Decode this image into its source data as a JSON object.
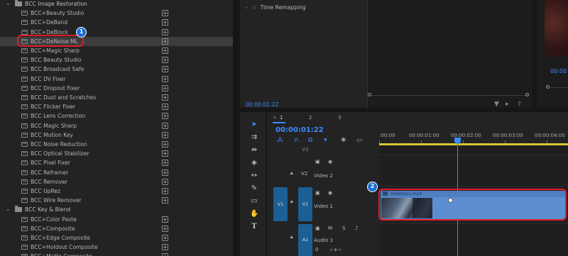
{
  "effects_panel": {
    "items": [
      {
        "type": "category",
        "label": "BCC Image Restoration"
      },
      {
        "type": "effect",
        "label": "BCC+Beauty Studio"
      },
      {
        "type": "effect",
        "label": "BCC+DeBand"
      },
      {
        "type": "effect",
        "label": "BCC+DeBlock"
      },
      {
        "type": "effect",
        "label": "BCC+DeNoise ML",
        "selected": true
      },
      {
        "type": "effect",
        "label": "BCC+Magic Sharp"
      },
      {
        "type": "effect",
        "label": "BCC Beauty Studio"
      },
      {
        "type": "effect",
        "label": "BCC Broadcast Safe"
      },
      {
        "type": "effect",
        "label": "BCC DV Fixer"
      },
      {
        "type": "effect",
        "label": "BCC Dropout Fixer"
      },
      {
        "type": "effect",
        "label": "BCC Dust and Scratches"
      },
      {
        "type": "effect",
        "label": "BCC Flicker Fixer"
      },
      {
        "type": "effect",
        "label": "BCC Lens Correction"
      },
      {
        "type": "effect",
        "label": "BCC Magic Sharp"
      },
      {
        "type": "effect",
        "label": "BCC Motion Key"
      },
      {
        "type": "effect",
        "label": "BCC Noise Reduction"
      },
      {
        "type": "effect",
        "label": "BCC Optical Stabilizer"
      },
      {
        "type": "effect",
        "label": "BCC Pixel Fixer"
      },
      {
        "type": "effect",
        "label": "BCC Reframer"
      },
      {
        "type": "effect",
        "label": "BCC Remover"
      },
      {
        "type": "effect",
        "label": "BCC UpRez"
      },
      {
        "type": "effect",
        "label": "BCC Wire Remover"
      },
      {
        "type": "category",
        "label": "BCC Key & Blend"
      },
      {
        "type": "effect",
        "label": "BCC+Color Paste"
      },
      {
        "type": "effect",
        "label": "BCC+Composite"
      },
      {
        "type": "effect",
        "label": "BCC+Edge Composite"
      },
      {
        "type": "effect",
        "label": "BCC+Holdout Composite"
      },
      {
        "type": "effect",
        "label": "BCC+Matte Composite"
      }
    ]
  },
  "annotations": [
    {
      "number": "1"
    },
    {
      "number": "2"
    }
  ],
  "effect_controls": {
    "property": "Time Remapping",
    "timecode": "00:00:01:22"
  },
  "program_monitor": {
    "timecode": "00:00"
  },
  "timeline": {
    "tabs": [
      "1",
      "2",
      "3"
    ],
    "close_glyph": "×",
    "timecode": "00:00:01:22",
    "ruler_labels": [
      ":00:00",
      "00:00:01:00",
      "00:00:02:00",
      "00:00:03:00",
      "00:00:04:00"
    ],
    "tracks": {
      "v3": {
        "name": "V3"
      },
      "v2": {
        "name": "V2",
        "label": "Video 2"
      },
      "v1": {
        "src": "V1",
        "name": "V1",
        "label": "Video 1"
      },
      "a1": {
        "name": "A1",
        "label": "Audio 1",
        "m": "M",
        "s": "S",
        "level": "0"
      }
    },
    "clip": {
      "name": "DeNoise1.mp4"
    }
  },
  "colors": {
    "accent": "#3e8bff",
    "highlight": "#e01c2a",
    "clip": "#5d8fd0",
    "work_area": "#d8c630"
  }
}
